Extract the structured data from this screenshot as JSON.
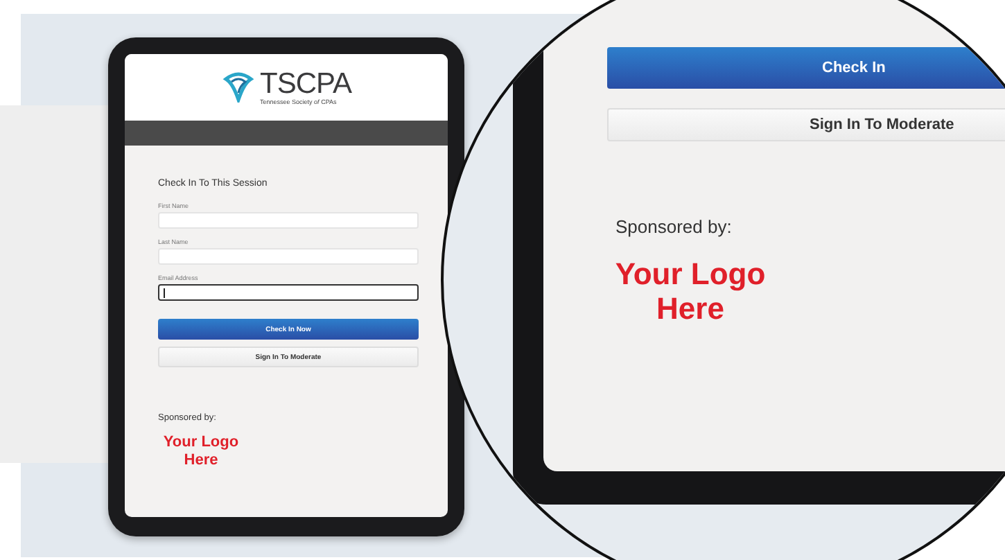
{
  "tablet": {
    "logo": {
      "name": "TSCPA",
      "tagline": "Tennessee Society *of* CPAs"
    },
    "form": {
      "heading": "Check In To This Session",
      "fields": [
        {
          "label": "First Name",
          "focused": false
        },
        {
          "label": "Last Name",
          "focused": false
        },
        {
          "label": "Email Address",
          "focused": true
        }
      ],
      "buttons": [
        {
          "label": "Check In Now",
          "kind": "primary"
        },
        {
          "label": "Sign In To Moderate",
          "kind": "secondary"
        }
      ]
    },
    "sponsor": {
      "label": "Sponsored by:",
      "logo_text": "Your Logo Here"
    }
  },
  "magnified": {
    "buttons": [
      {
        "label": "Check In",
        "kind": "primary"
      },
      {
        "label": "Sign In To Moderate",
        "kind": "secondary"
      }
    ],
    "sponsor": {
      "label": "Sponsored by:",
      "logo_text": "Your Logo Here"
    }
  }
}
